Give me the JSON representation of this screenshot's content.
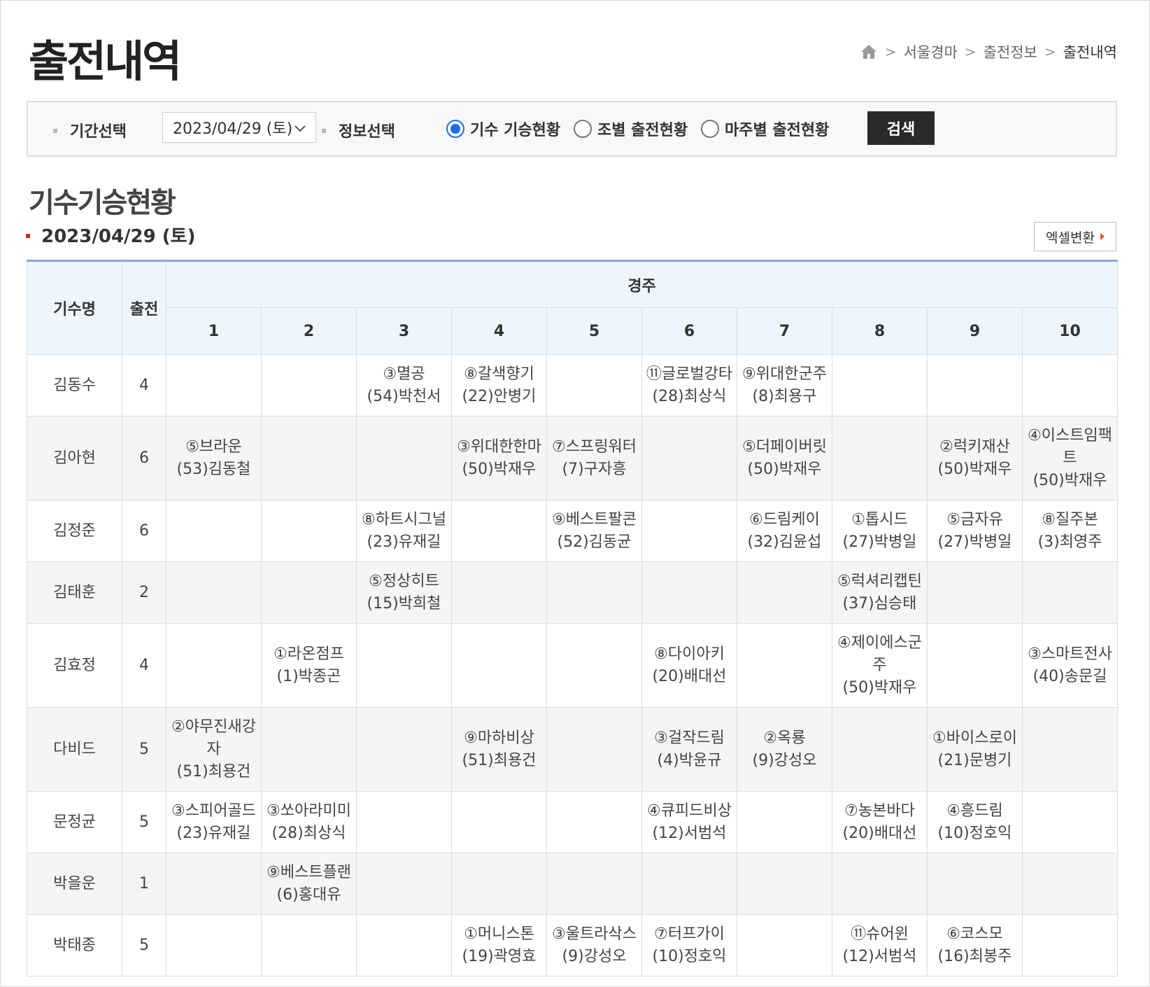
{
  "page": {
    "title": "출전내역",
    "breadcrumb": [
      "서울경마",
      "출전정보",
      "출전내역"
    ]
  },
  "search": {
    "period_label": "기간선택",
    "date_value": "2023/04/29 (토)",
    "info_label": "정보선택",
    "radios": [
      {
        "label": "기수 기승현황",
        "checked": true
      },
      {
        "label": "조별 출전현황",
        "checked": false
      },
      {
        "label": "마주별 출전현황",
        "checked": false
      }
    ],
    "button": "검색"
  },
  "section": {
    "title": "기수기승현황",
    "date": "2023/04/29 (토)",
    "excel_button": "엑셀변환"
  },
  "table": {
    "headers": {
      "jockey": "기수명",
      "starts": "출전",
      "race_group": "경주"
    },
    "races": [
      "1",
      "2",
      "3",
      "4",
      "5",
      "6",
      "7",
      "8",
      "9",
      "10"
    ],
    "rows": [
      {
        "jockey": "김동수",
        "starts": "4",
        "cells": [
          [],
          [],
          [
            "③멸공",
            "(54)박천서"
          ],
          [
            "⑧갈색향기",
            "(22)안병기"
          ],
          [],
          [
            "⑪글로벌강타",
            "(28)최상식"
          ],
          [
            "⑨위대한군주",
            "(8)최용구"
          ],
          [],
          [],
          []
        ]
      },
      {
        "jockey": "김아현",
        "starts": "6",
        "cells": [
          [
            "⑤브라운",
            "(53)김동철"
          ],
          [],
          [],
          [
            "③위대한한마",
            "(50)박재우"
          ],
          [
            "⑦스프링워터",
            "(7)구자흥"
          ],
          [],
          [
            "⑤더페이버릿",
            "(50)박재우"
          ],
          [],
          [
            "②럭키재산",
            "(50)박재우"
          ],
          [
            "④이스트임팩",
            "트",
            "(50)박재우"
          ]
        ]
      },
      {
        "jockey": "김정준",
        "starts": "6",
        "cells": [
          [],
          [],
          [
            "⑧하트시그널",
            "(23)유재길"
          ],
          [],
          [
            "⑨베스트팔콘",
            "(52)김동균"
          ],
          [],
          [
            "⑥드림케이",
            "(32)김윤섭"
          ],
          [
            "①톱시드",
            "(27)박병일"
          ],
          [
            "⑤금자유",
            "(27)박병일"
          ],
          [
            "⑧질주본",
            "(3)최영주"
          ]
        ]
      },
      {
        "jockey": "김태훈",
        "starts": "2",
        "cells": [
          [],
          [],
          [
            "⑤정상히트",
            "(15)박희철"
          ],
          [],
          [],
          [],
          [],
          [
            "⑤럭셔리캡틴",
            "(37)심승태"
          ],
          [],
          []
        ]
      },
      {
        "jockey": "김효정",
        "starts": "4",
        "cells": [
          [],
          [
            "①라온점프",
            "(1)박종곤"
          ],
          [],
          [],
          [],
          [
            "⑧다이아키",
            "(20)배대선"
          ],
          [],
          [
            "④제이에스군",
            "주",
            "(50)박재우"
          ],
          [],
          [
            "③스마트전사",
            "(40)송문길"
          ]
        ]
      },
      {
        "jockey": "다비드",
        "starts": "5",
        "cells": [
          [
            "②야무진새강",
            "자",
            "(51)최용건"
          ],
          [],
          [],
          [
            "⑨마하비상",
            "(51)최용건"
          ],
          [],
          [
            "③걸작드림",
            "(4)박윤규"
          ],
          [
            "②옥룡",
            "(9)강성오"
          ],
          [],
          [
            "①바이스로이",
            "(21)문병기"
          ],
          []
        ]
      },
      {
        "jockey": "문정균",
        "starts": "5",
        "cells": [
          [
            "③스피어골드",
            "(23)유재길"
          ],
          [
            "③쏘아라미미",
            "(28)최상식"
          ],
          [],
          [],
          [],
          [
            "④큐피드비상",
            "(12)서범석"
          ],
          [],
          [
            "⑦농본바다",
            "(20)배대선"
          ],
          [
            "④흥드림",
            "(10)정호익"
          ],
          []
        ]
      },
      {
        "jockey": "박을운",
        "starts": "1",
        "cells": [
          [],
          [
            "⑨베스트플랜",
            "(6)홍대유"
          ],
          [],
          [],
          [],
          [],
          [],
          [],
          [],
          []
        ]
      },
      {
        "jockey": "박태종",
        "starts": "5",
        "cells": [
          [],
          [],
          [],
          [
            "①머니스톤",
            "(19)곽영효"
          ],
          [
            "③울트라삭스",
            "(9)강성오"
          ],
          [
            "⑦터프가이",
            "(10)정호익"
          ],
          [],
          [
            "⑪슈어윈",
            "(12)서범석"
          ],
          [
            "⑥코스모",
            "(16)최봉주"
          ],
          []
        ]
      }
    ]
  }
}
